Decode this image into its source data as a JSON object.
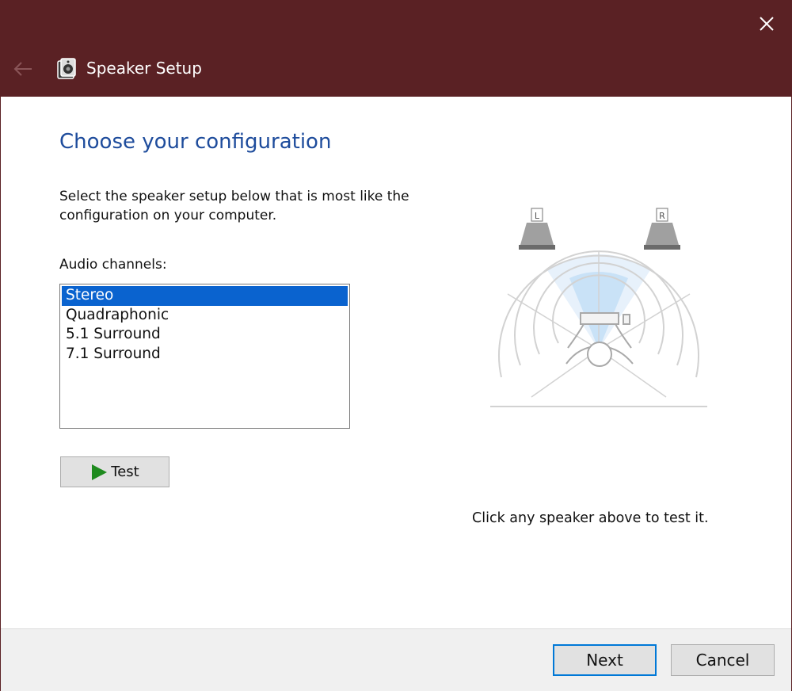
{
  "window": {
    "title": "Speaker Setup",
    "titlebar_color": "#5a2124"
  },
  "icons": {
    "back": "back-arrow-icon",
    "close": "close-icon",
    "app": "speaker-icon"
  },
  "main": {
    "heading": "Choose your configuration",
    "instructions": "Select the speaker setup below that is most like the configuration on your computer.",
    "channels_label": "Audio channels:",
    "channels": [
      {
        "label": "Stereo",
        "selected": true
      },
      {
        "label": "Quadraphonic",
        "selected": false
      },
      {
        "label": "5.1 Surround",
        "selected": false
      },
      {
        "label": "7.1 Surround",
        "selected": false
      }
    ],
    "test_label": "Test"
  },
  "diagram": {
    "left_speaker_label": "L",
    "right_speaker_label": "R",
    "hint": "Click any speaker above to test it."
  },
  "footer": {
    "next_label": "Next",
    "cancel_label": "Cancel"
  },
  "colors": {
    "heading": "#1e4c9c",
    "selection": "#0a63cf",
    "focus_border": "#0078d7",
    "play_icon": "#1e8a1e"
  }
}
